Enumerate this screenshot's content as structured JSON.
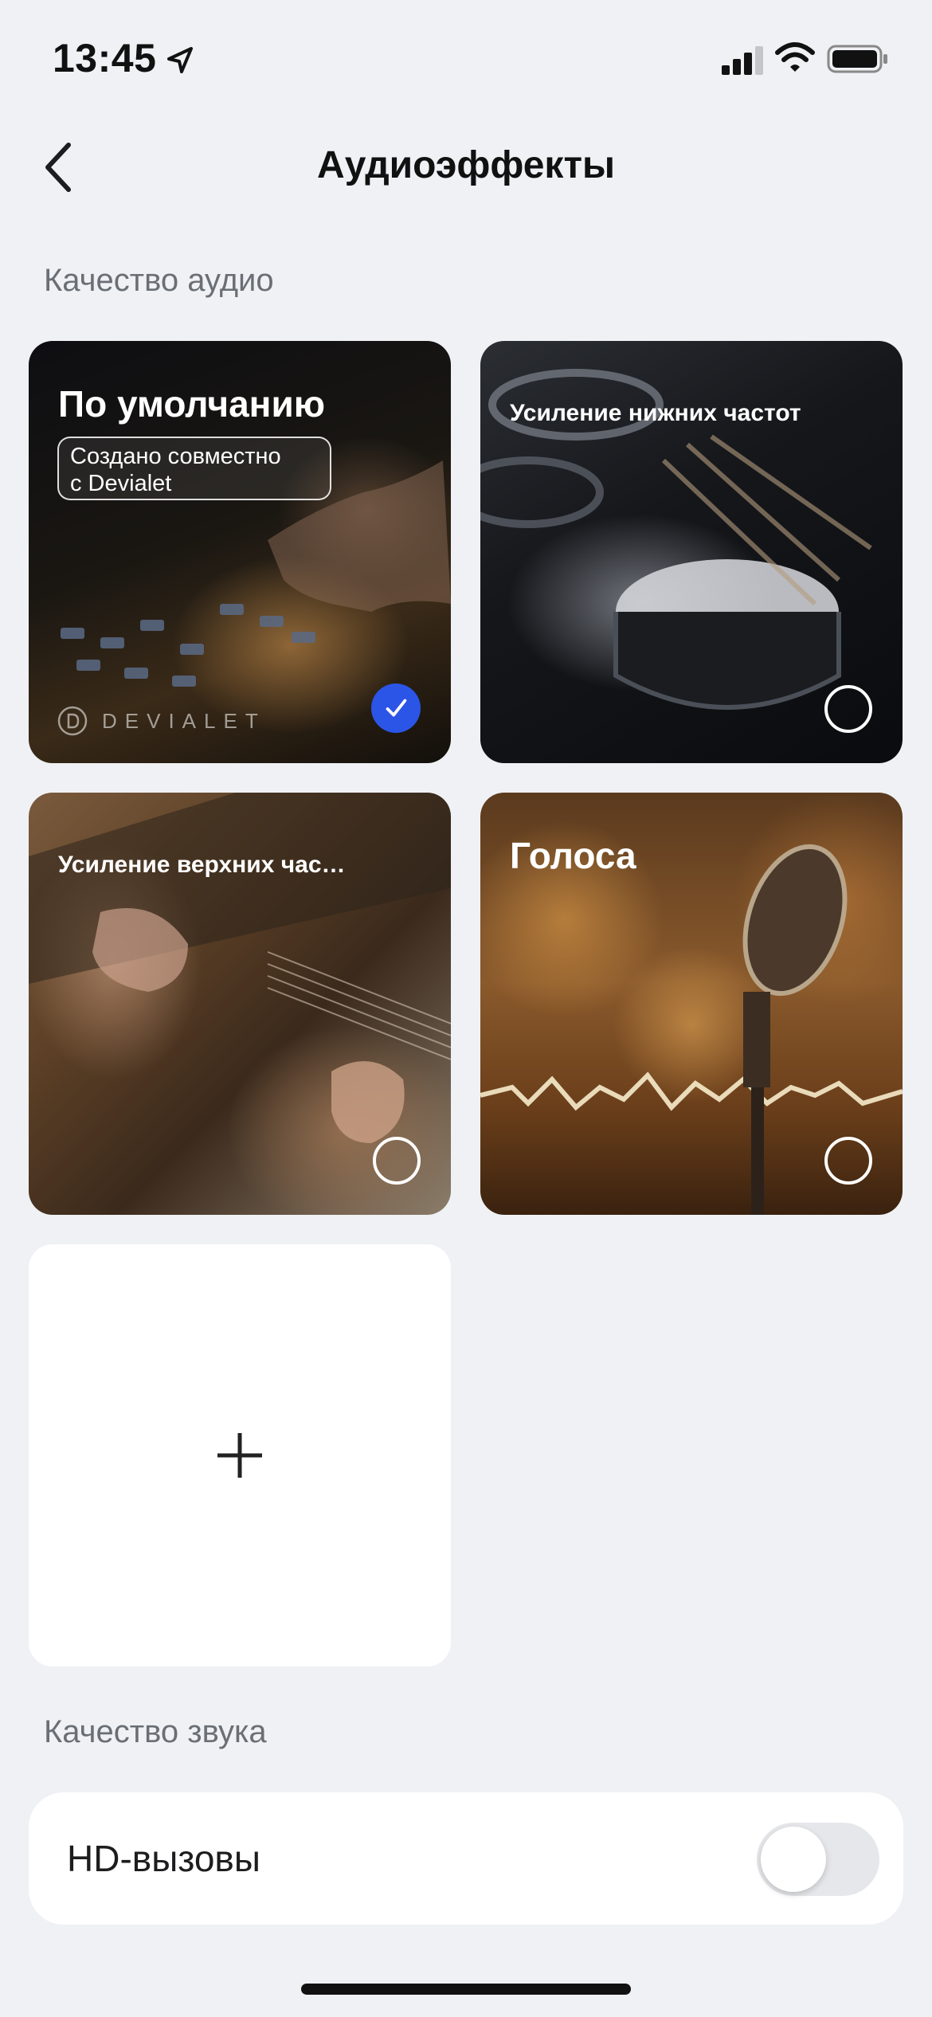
{
  "status_bar": {
    "time": "13:45"
  },
  "nav": {
    "title": "Аудиоэффекты"
  },
  "sections": {
    "audio_quality": "Качество аудио",
    "sound_quality": "Качество звука"
  },
  "cards": [
    {
      "title": "По умолчанию",
      "badge_line1": "Создано совместно",
      "badge_line2": "с Devialet",
      "brand": "DEVIALET",
      "selected": true
    },
    {
      "title": "Усиление нижних частот",
      "selected": false
    },
    {
      "title": "Усиление верхних частот",
      "selected": false
    },
    {
      "title": "Голоса",
      "selected": false
    }
  ],
  "hd_calls": {
    "label": "HD-вызовы",
    "enabled": false
  },
  "colors": {
    "accent": "#2b55e6",
    "background": "#eff1f4"
  }
}
